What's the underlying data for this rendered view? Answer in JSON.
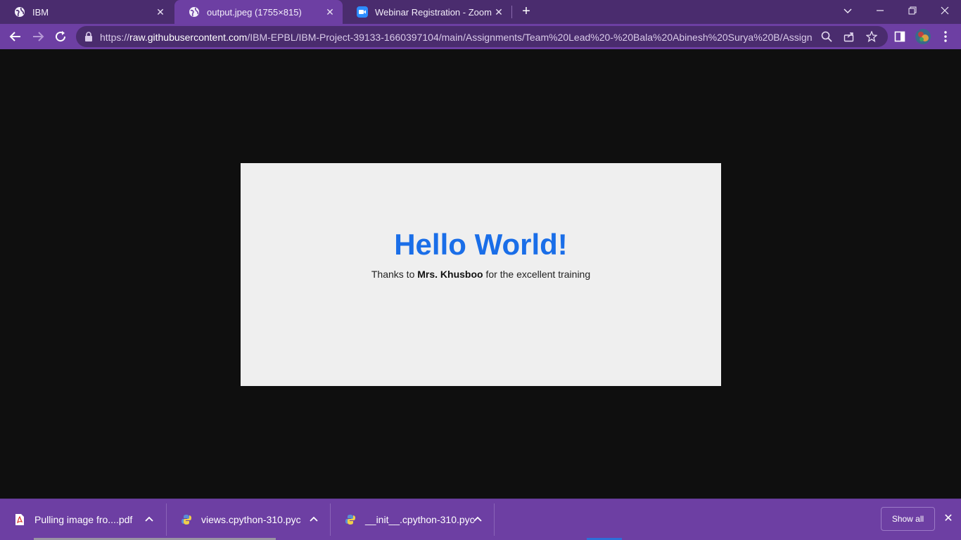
{
  "tabs": [
    {
      "label": "IBM",
      "icon": "globe-icon"
    },
    {
      "label": "output.jpeg (1755×815)",
      "icon": "globe-icon"
    },
    {
      "label": "Webinar Registration - Zoom",
      "icon": "zoom-video-icon"
    }
  ],
  "omnibox": {
    "url_prefix": "https://",
    "url_host": "raw.githubusercontent.com",
    "url_path": "/IBM-EPBL/IBM-Project-39133-1660397104/main/Assignments/Team%20Lead%20-%20Bala%20Abinesh%20Surya%20B/Assign..."
  },
  "image": {
    "title": "Hello World!",
    "thanks_before": "Thanks to ",
    "thanks_name": "Mrs. Khusboo",
    "thanks_after": " for the excellent training"
  },
  "downloads": [
    {
      "name": "Pulling image fro....pdf",
      "icon": "pdf-file-icon"
    },
    {
      "name": "views.cpython-310.pyc",
      "icon": "python-file-icon"
    },
    {
      "name": "__init__.cpython-310.pyc",
      "icon": "python-file-icon"
    }
  ],
  "download_bar": {
    "show_all_label": "Show all"
  },
  "colors": {
    "tab_bar": "#4a2c6e",
    "toolbar": "#6d3fa3",
    "title_blue": "#1a6ee8"
  }
}
